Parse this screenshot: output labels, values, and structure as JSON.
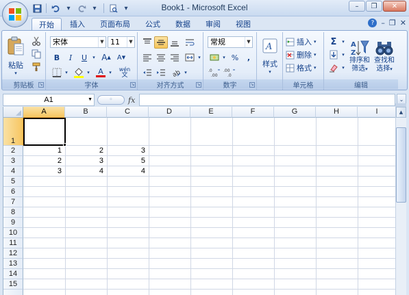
{
  "window": {
    "title": "Book1 - Microsoft Excel",
    "controls": {
      "minimize": "–",
      "restore": "❐",
      "close": "✕"
    }
  },
  "quick_access": {
    "save_icon": "save-icon",
    "undo_icon": "undo-icon",
    "redo_icon": "redo-icon",
    "print_preview_icon": "print-preview-icon",
    "dropdown_glyph": "▾"
  },
  "tabs": [
    {
      "label": "开始",
      "active": true
    },
    {
      "label": "插入",
      "active": false
    },
    {
      "label": "页面布局",
      "active": false
    },
    {
      "label": "公式",
      "active": false
    },
    {
      "label": "数据",
      "active": false
    },
    {
      "label": "审阅",
      "active": false
    },
    {
      "label": "视图",
      "active": false
    }
  ],
  "ribbon": {
    "clipboard": {
      "label": "剪贴板",
      "paste_label": "粘贴"
    },
    "font": {
      "label": "字体",
      "font_name": "宋体",
      "font_size": "11",
      "bold": "B",
      "italic": "I",
      "underline": "U",
      "grow": "A",
      "shrink": "A",
      "font_color_letter": "A",
      "wen_label": "wén"
    },
    "alignment": {
      "label": "对齐方式"
    },
    "number": {
      "label": "数字",
      "format": "常规",
      "percent": "%",
      "comma": ","
    },
    "styles": {
      "label": "样式"
    },
    "cells": {
      "label": "单元格",
      "insert": "插入",
      "delete": "删除",
      "format": "格式"
    },
    "editing": {
      "label": "编辑",
      "sigma": "Σ",
      "sort_label_1": "排序和",
      "sort_label_2": "筛选",
      "find_label_1": "查找和",
      "find_label_2": "选择"
    }
  },
  "formula_bar": {
    "name_box": "A1",
    "fx": "fx",
    "value": ""
  },
  "colors": {
    "accent": "#15428b",
    "selected_header": "#f7c661",
    "gridline": "#d0d7e5"
  },
  "sheet": {
    "columns": [
      "A",
      "B",
      "C",
      "D",
      "E",
      "F",
      "G",
      "H",
      "I"
    ],
    "rows": [
      "1",
      "2",
      "3",
      "4",
      "5",
      "6",
      "7",
      "8",
      "9",
      "10",
      "11",
      "12",
      "13",
      "14",
      "15"
    ],
    "selected_cell": "A1",
    "cells": {
      "A2": "1",
      "B2": "2",
      "C2": "3",
      "A3": "2",
      "B3": "3",
      "C3": "5",
      "A4": "3",
      "B4": "4",
      "C4": "4"
    }
  }
}
